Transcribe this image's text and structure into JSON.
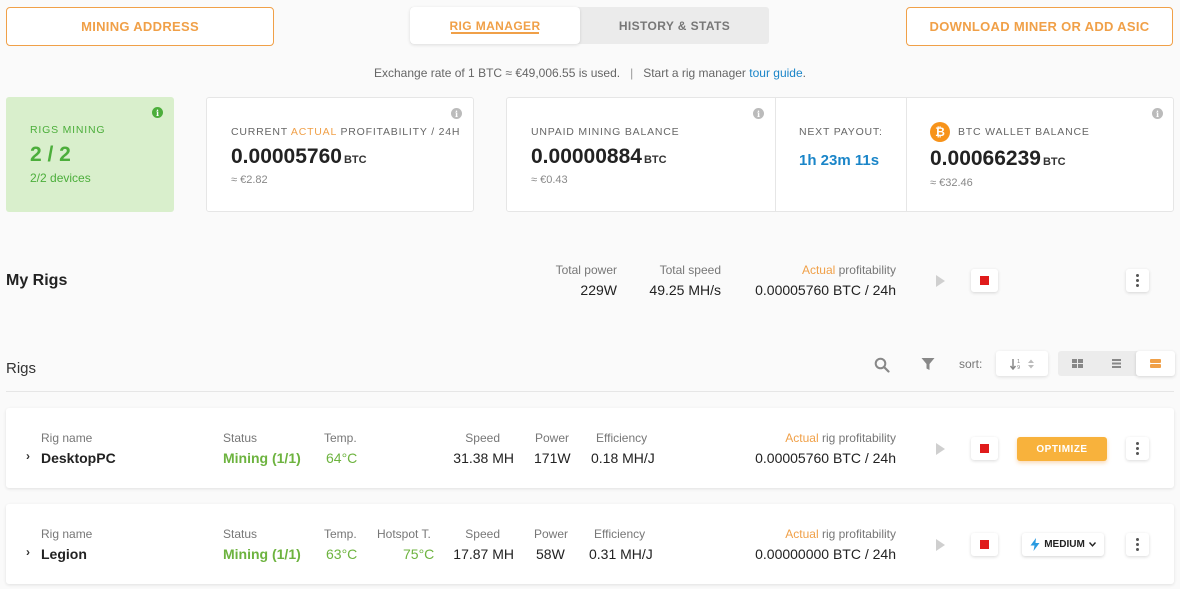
{
  "top_nav": {
    "mining_address_label": "MINING ADDRESS",
    "tabs": [
      {
        "label": "RIG MANAGER",
        "active": true
      },
      {
        "label": "HISTORY & STATS",
        "active": false
      }
    ],
    "download_label": "DOWNLOAD MINER OR ADD ASIC"
  },
  "info_bar": {
    "exchange_text": "Exchange rate of 1 BTC ≈ €49,006.55 is used.",
    "separator": "|",
    "guide_prefix": "Start a rig manager ",
    "guide_link": "tour guide",
    "guide_suffix": "."
  },
  "summary": {
    "rigs_mining": {
      "label": "RIGS MINING",
      "value": "2 / 2",
      "sub": "2/2 devices"
    },
    "profitability": {
      "label_pre": "CURRENT ",
      "label_accent": "ACTUAL",
      "label_post": " PROFITABILITY / 24H",
      "value": "0.00005760",
      "unit": "BTC",
      "fiat": "≈ €2.82"
    },
    "unpaid": {
      "label": "UNPAID MINING BALANCE",
      "value": "0.00000884",
      "unit": "BTC",
      "fiat": "≈ €0.43"
    },
    "next_payout": {
      "label": "NEXT PAYOUT:",
      "value": "1h 23m 11s"
    },
    "wallet": {
      "label": "BTC WALLET BALANCE",
      "value": "0.00066239",
      "unit": "BTC",
      "fiat": "≈ €32.46"
    }
  },
  "my_rigs": {
    "title": "My Rigs",
    "total_power_label": "Total power",
    "total_power": "229W",
    "total_speed_label": "Total speed",
    "total_speed": "49.25 MH/s",
    "profit_label_accent": "Actual",
    "profit_label_rest": " profitability",
    "profit_value": "0.00005760 BTC / 24h"
  },
  "rigs_toolbar": {
    "title": "Rigs",
    "sort_label": "sort:"
  },
  "rigs": [
    {
      "name_label": "Rig name",
      "name": "DesktopPC",
      "status_label": "Status",
      "status": "Mining (1/1)",
      "temp_label": "Temp.",
      "temp": "64°C",
      "speed_label": "Speed",
      "speed": "31.38 MH",
      "power_label": "Power",
      "power": "171W",
      "eff_label": "Efficiency",
      "eff": "0.18 MH/J",
      "profit_label_accent": "Actual",
      "profit_label_rest": " rig profitability",
      "profit": "0.00005760 BTC / 24h",
      "action": "OPTIMIZE"
    },
    {
      "name_label": "Rig name",
      "name": "Legion",
      "status_label": "Status",
      "status": "Mining (1/1)",
      "temp_label": "Temp.",
      "temp": "63°C",
      "hotspot_label": "Hotspot T.",
      "hotspot": "75°C",
      "speed_label": "Speed",
      "speed": "17.87 MH",
      "power_label": "Power",
      "power": "58W",
      "eff_label": "Efficiency",
      "eff": "0.31 MH/J",
      "profit_label_accent": "Actual",
      "profit_label_rest": " rig profitability",
      "profit": "0.00000000 BTC / 24h",
      "action": "MEDIUM"
    }
  ],
  "colors": {
    "accent": "#f0a048",
    "green": "#6db33f",
    "stop_red": "#e01b1b",
    "link_blue": "#1a85c8",
    "bitcoin_orange": "#f7931a"
  }
}
